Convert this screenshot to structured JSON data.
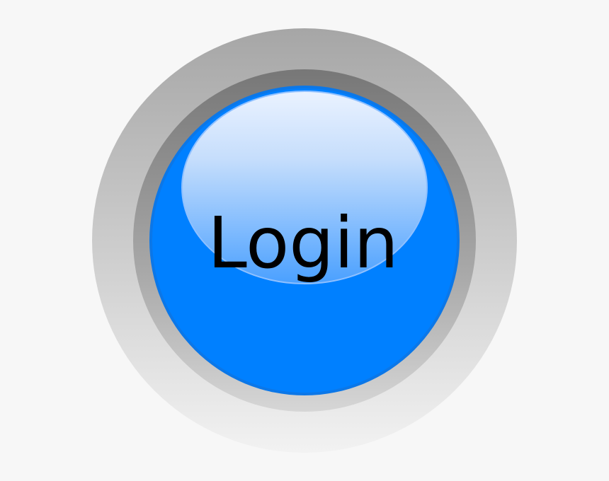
{
  "button": {
    "label": "Login"
  },
  "colors": {
    "background": "#f7f7f7",
    "outer_ring_top": "#a8a8a8",
    "outer_ring_bottom": "#f0f0f0",
    "inner_ring_top": "#7a7a7a",
    "inner_ring_bottom": "#d0d0d0",
    "face": "#0080ff",
    "face_edge": "#1a73d9",
    "gloss_top": "#e6f0ff",
    "gloss_bottom": "#5aa8ff",
    "label": "#000000"
  }
}
